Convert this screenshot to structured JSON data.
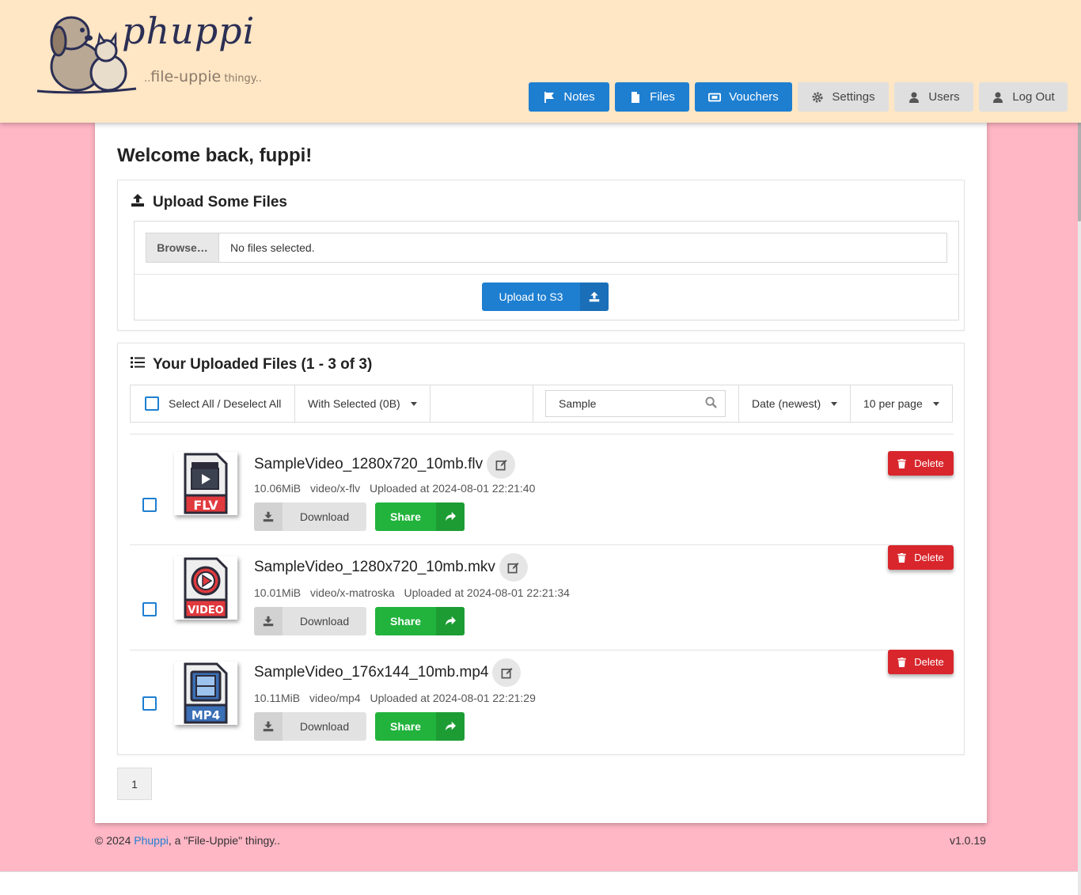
{
  "brand": {
    "logo_word": "phuppi",
    "tag_prefix": "..",
    "tag_main": "file-uppie",
    "tag_suffix": " thingy.."
  },
  "nav": [
    {
      "label": "Notes",
      "icon": "flag-icon",
      "style": "primary"
    },
    {
      "label": "Files",
      "icon": "file-icon",
      "style": "primary"
    },
    {
      "label": "Vouchers",
      "icon": "ticket-icon",
      "style": "primary"
    },
    {
      "label": "Settings",
      "icon": "gear-icon",
      "style": "light"
    },
    {
      "label": "Users",
      "icon": "user-icon",
      "style": "light"
    },
    {
      "label": "Log Out",
      "icon": "user-icon",
      "style": "light"
    }
  ],
  "welcome": "Welcome back, fuppi!",
  "upload": {
    "title": "Upload Some Files",
    "browse_label": "Browse…",
    "status": "No files selected.",
    "button_label": "Upload to S3"
  },
  "files_panel": {
    "title": "Your Uploaded Files (1 - 3 of 3)",
    "select_all_label": "Select All / Deselect All",
    "with_selected_label": "With Selected (0B)",
    "search_value": "Sample",
    "sort_label": "Date (newest)",
    "per_page_label": "10 per page"
  },
  "files": [
    {
      "name": "SampleVideo_1280x720_10mb.flv",
      "size": "10.06MiB",
      "mime": "video/x-flv",
      "uploaded": "Uploaded at 2024-08-01 22:21:40",
      "thumb_label": "FLV",
      "thumb_icon": "clapperboard-icon"
    },
    {
      "name": "SampleVideo_1280x720_10mb.mkv",
      "size": "10.01MiB",
      "mime": "video/x-matroska",
      "uploaded": "Uploaded at 2024-08-01 22:21:34",
      "thumb_label": "VIDEO",
      "thumb_icon": "play-circle-icon"
    },
    {
      "name": "SampleVideo_176x144_10mb.mp4",
      "size": "10.11MiB",
      "mime": "video/mp4",
      "uploaded": "Uploaded at 2024-08-01 22:21:29",
      "thumb_label": "MP4",
      "thumb_icon": "film-icon"
    }
  ],
  "row_actions": {
    "download_label": "Download",
    "share_label": "Share",
    "delete_label": "Delete"
  },
  "pagination": {
    "current_page": "1"
  },
  "footer": {
    "copyright_prefix": "© 2024 ",
    "brand_link": "Phuppi",
    "copyright_suffix": ", a \"File-Uppie\" thingy..",
    "version": "v1.0.19"
  },
  "colors": {
    "header_bg": "#ffe6c4",
    "page_bg": "#ffb6c5",
    "primary": "#1e7fd1",
    "success": "#22b33c",
    "danger": "#d8262c"
  }
}
